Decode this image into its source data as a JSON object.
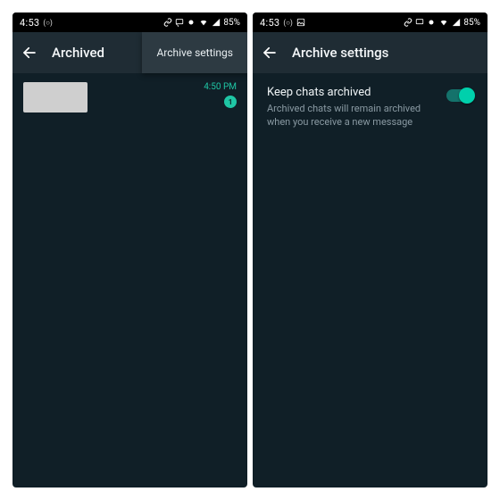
{
  "status": {
    "time": "4:53",
    "rec_indicator": "(○)",
    "battery_percent": "85%",
    "icons": [
      "link",
      "cast",
      "camera",
      "wifi",
      "signal",
      "battery"
    ],
    "extra_icon_right_screen": "image"
  },
  "left": {
    "title": "Archived",
    "menu_item": "Archive settings",
    "chat": {
      "time": "4:50 PM",
      "badge": "1"
    }
  },
  "right": {
    "title": "Archive settings",
    "setting": {
      "title": "Keep chats archived",
      "desc": "Archived chats will remain archived when you receive a new message",
      "enabled": true
    }
  },
  "colors": {
    "accent": "#00d0ac",
    "bg": "#101f27",
    "bar": "#1f2c34"
  }
}
